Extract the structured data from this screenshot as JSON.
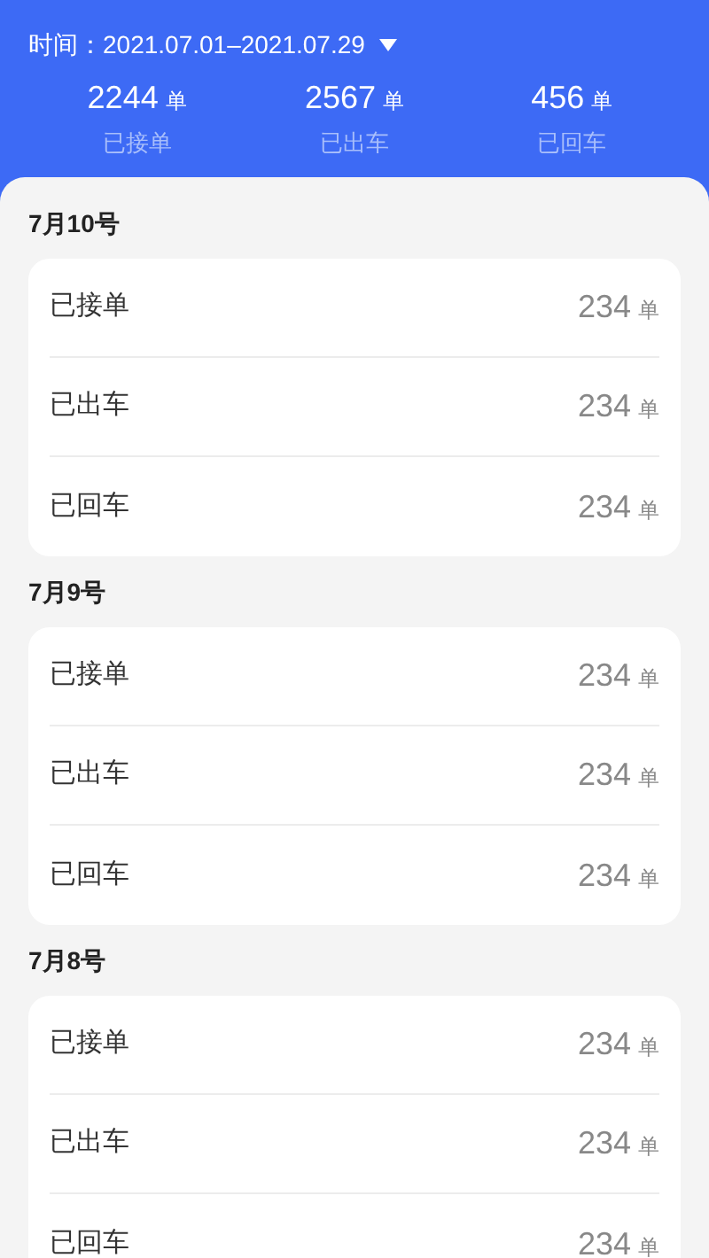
{
  "filter": {
    "label": "时间：",
    "value": "2021.07.01–2021.07.29"
  },
  "summary": [
    {
      "value": "2244",
      "unit": "单",
      "label": "已接单"
    },
    {
      "value": "2567",
      "unit": "单",
      "label": "已出车"
    },
    {
      "value": "456",
      "unit": "单",
      "label": "已回车"
    }
  ],
  "days": [
    {
      "date": "7月10号",
      "rows": [
        {
          "label": "已接单",
          "value": "234",
          "unit": "单"
        },
        {
          "label": "已出车",
          "value": "234",
          "unit": "单"
        },
        {
          "label": "已回车",
          "value": "234",
          "unit": "单"
        }
      ]
    },
    {
      "date": "7月9号",
      "rows": [
        {
          "label": "已接单",
          "value": "234",
          "unit": "单"
        },
        {
          "label": "已出车",
          "value": "234",
          "unit": "单"
        },
        {
          "label": "已回车",
          "value": "234",
          "unit": "单"
        }
      ]
    },
    {
      "date": "7月8号",
      "rows": [
        {
          "label": "已接单",
          "value": "234",
          "unit": "单"
        },
        {
          "label": "已出车",
          "value": "234",
          "unit": "单"
        },
        {
          "label": "已回车",
          "value": "234",
          "unit": "单"
        }
      ]
    }
  ]
}
